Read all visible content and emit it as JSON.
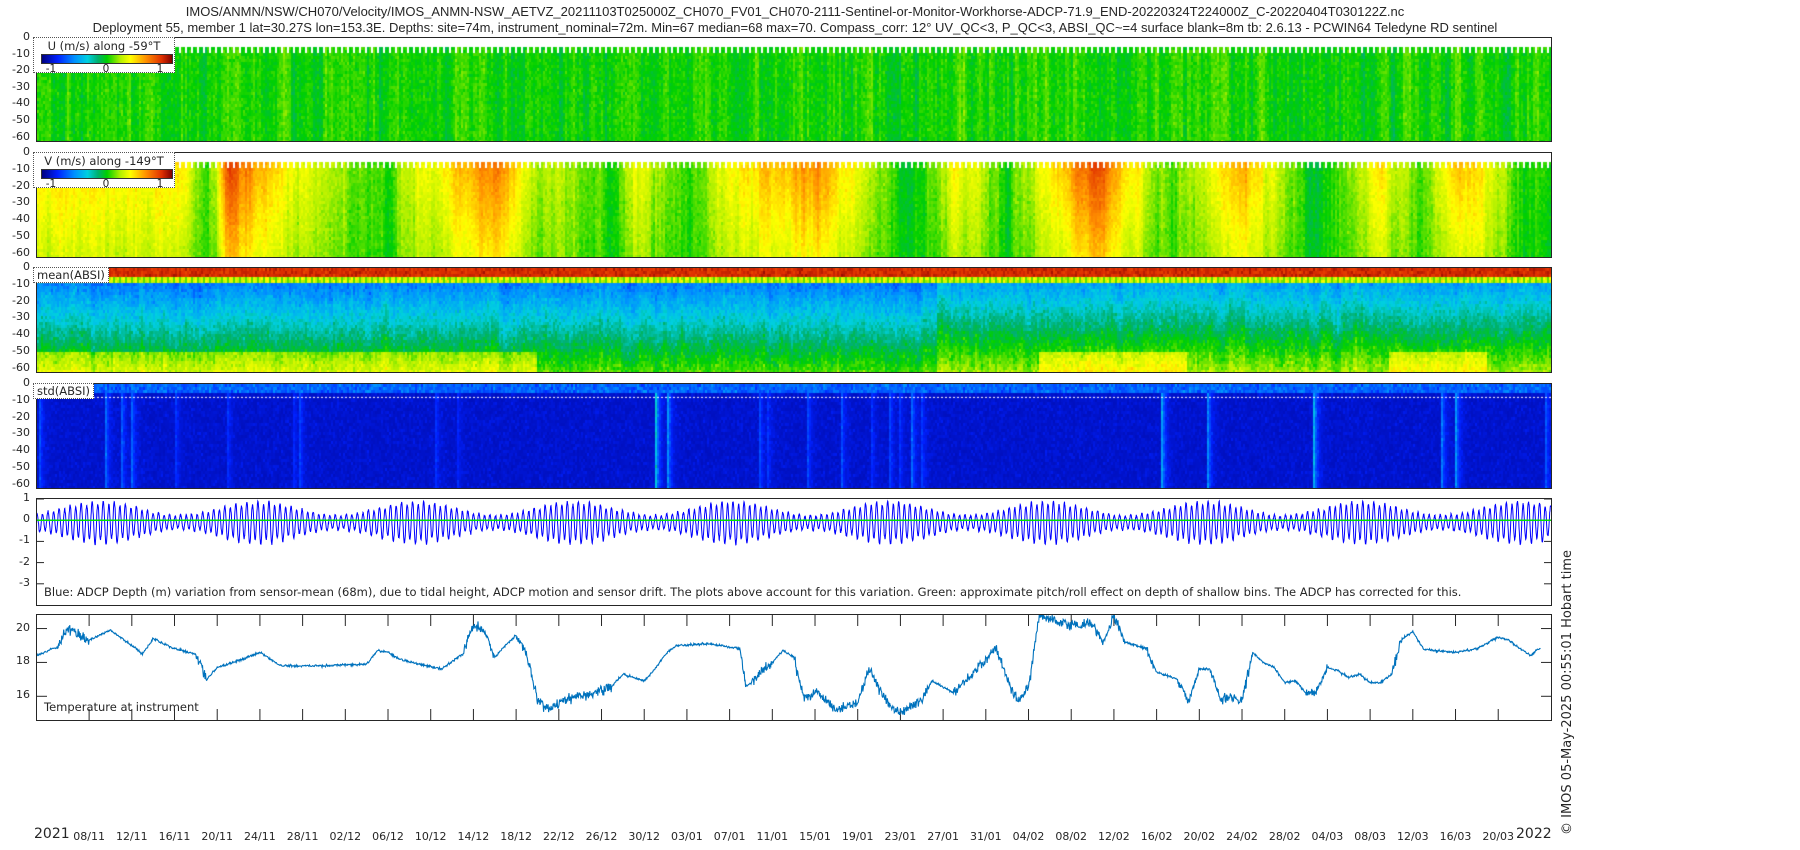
{
  "header": {
    "title_line1": "IMOS/ANMN/NSW/CH070/Velocity/IMOS_ANMN-NSW_AETVZ_20211103T025000Z_CH070_FV01_CH070-2111-Sentinel-or-Monitor-Workhorse-ADCP-71.9_END-20220324T224000Z_C-20220404T030122Z.nc",
    "title_line2": "Deployment 55, member 1 lat=30.27S lon=153.3E. Depths: site=74m, instrument_nominal=72m. Min=67 median=68 max=70. Compass_corr: 12° UV_QC<3, P_QC<3, ABSI_QC~=4 surface blank=8m tb: 2.6.13 - PCWIN64 Teledyne RD sentinel"
  },
  "footer": {
    "credit": "© IMOS 05-May-2025 00:55:01 Hobart time"
  },
  "xaxis": {
    "start": "2021-11-03T02:50:00Z",
    "end": "2022-03-24T22:40:00Z",
    "year_start": "2021",
    "year_end": "2022",
    "ticks": [
      {
        "date": "2021-11-08",
        "label": "08/11"
      },
      {
        "date": "2021-11-12",
        "label": "12/11"
      },
      {
        "date": "2021-11-16",
        "label": "16/11"
      },
      {
        "date": "2021-11-20",
        "label": "20/11"
      },
      {
        "date": "2021-11-24",
        "label": "24/11"
      },
      {
        "date": "2021-11-28",
        "label": "28/11"
      },
      {
        "date": "2021-12-02",
        "label": "02/12"
      },
      {
        "date": "2021-12-06",
        "label": "06/12"
      },
      {
        "date": "2021-12-10",
        "label": "10/12"
      },
      {
        "date": "2021-12-14",
        "label": "14/12"
      },
      {
        "date": "2021-12-18",
        "label": "18/12"
      },
      {
        "date": "2021-12-22",
        "label": "22/12"
      },
      {
        "date": "2021-12-26",
        "label": "26/12"
      },
      {
        "date": "2021-12-30",
        "label": "30/12"
      },
      {
        "date": "2022-01-03",
        "label": "03/01"
      },
      {
        "date": "2022-01-07",
        "label": "07/01"
      },
      {
        "date": "2022-01-11",
        "label": "11/01"
      },
      {
        "date": "2022-01-15",
        "label": "15/01"
      },
      {
        "date": "2022-01-19",
        "label": "19/01"
      },
      {
        "date": "2022-01-23",
        "label": "23/01"
      },
      {
        "date": "2022-01-27",
        "label": "27/01"
      },
      {
        "date": "2022-01-31",
        "label": "31/01"
      },
      {
        "date": "2022-02-04",
        "label": "04/02"
      },
      {
        "date": "2022-02-08",
        "label": "08/02"
      },
      {
        "date": "2022-02-12",
        "label": "12/02"
      },
      {
        "date": "2022-02-16",
        "label": "16/02"
      },
      {
        "date": "2022-02-20",
        "label": "20/02"
      },
      {
        "date": "2022-02-24",
        "label": "24/02"
      },
      {
        "date": "2022-02-28",
        "label": "28/02"
      },
      {
        "date": "2022-03-04",
        "label": "04/03"
      },
      {
        "date": "2022-03-08",
        "label": "08/03"
      },
      {
        "date": "2022-03-12",
        "label": "12/03"
      },
      {
        "date": "2022-03-16",
        "label": "16/03"
      },
      {
        "date": "2022-03-20",
        "label": "20/03"
      }
    ]
  },
  "chart_data": [
    {
      "type": "heatmap",
      "id": "u",
      "label": "U (m/s) along -59°T",
      "colorbar": {
        "range": [
          -1.2,
          1.2
        ],
        "ticks": [
          {
            "value": -1,
            "label": "-1"
          },
          {
            "value": 0,
            "label": "0"
          },
          {
            "value": 1,
            "label": "1"
          }
        ]
      },
      "ylim": [
        -62,
        0
      ],
      "yticks": [
        {
          "value": 0,
          "label": "0"
        },
        {
          "value": -10,
          "label": "-10"
        },
        {
          "value": -20,
          "label": "-20"
        },
        {
          "value": -30,
          "label": "-30"
        },
        {
          "value": -40,
          "label": "-40"
        },
        {
          "value": -50,
          "label": "-50"
        },
        {
          "value": -60,
          "label": "-60"
        }
      ],
      "typical_value": 0.0,
      "typical_spread": 0.25
    },
    {
      "type": "heatmap",
      "id": "v",
      "label": "V (m/s) along -149°T",
      "colorbar": {
        "range": [
          -1.2,
          1.2
        ],
        "ticks": [
          {
            "value": -1,
            "label": "-1"
          },
          {
            "value": 0,
            "label": "0"
          },
          {
            "value": 1,
            "label": "1"
          }
        ]
      },
      "ylim": [
        -62,
        0
      ],
      "yticks": [
        {
          "value": 0,
          "label": "0"
        },
        {
          "value": -10,
          "label": "-10"
        },
        {
          "value": -20,
          "label": "-20"
        },
        {
          "value": -30,
          "label": "-30"
        },
        {
          "value": -40,
          "label": "-40"
        },
        {
          "value": -50,
          "label": "-50"
        },
        {
          "value": -60,
          "label": "-60"
        }
      ],
      "depth_mean_by_date": [
        [
          "2021-11-03",
          0.4
        ],
        [
          "2021-11-17",
          0.4
        ],
        [
          "2021-11-19",
          0.0
        ],
        [
          "2021-11-21",
          0.75
        ],
        [
          "2021-11-27",
          0.35
        ],
        [
          "2021-12-05",
          0.05
        ],
        [
          "2021-12-11",
          0.4
        ],
        [
          "2021-12-16",
          0.65
        ],
        [
          "2021-12-20",
          0.25
        ],
        [
          "2021-12-27",
          0.05
        ],
        [
          "2021-12-29",
          0.35
        ],
        [
          "2022-01-03",
          0.05
        ],
        [
          "2022-01-08",
          0.4
        ],
        [
          "2022-01-15",
          0.65
        ],
        [
          "2022-01-24",
          -0.1
        ],
        [
          "2022-01-28",
          0.4
        ],
        [
          "2022-02-02",
          0.05
        ],
        [
          "2022-02-10",
          0.8
        ],
        [
          "2022-02-17",
          0.05
        ],
        [
          "2022-02-24",
          0.55
        ],
        [
          "2022-03-03",
          -0.1
        ],
        [
          "2022-03-09",
          0.4
        ],
        [
          "2022-03-13",
          0.05
        ],
        [
          "2022-03-16",
          0.55
        ],
        [
          "2022-03-22",
          0.05
        ],
        [
          "2022-03-24",
          0.1
        ]
      ]
    },
    {
      "type": "heatmap",
      "id": "mean_absi",
      "label": "mean(ABSI)",
      "ylim": [
        -62,
        0
      ],
      "yticks": [
        {
          "value": 0,
          "label": "0"
        },
        {
          "value": -10,
          "label": "-10"
        },
        {
          "value": -20,
          "label": "-20"
        },
        {
          "value": -30,
          "label": "-30"
        },
        {
          "value": -40,
          "label": "-40"
        },
        {
          "value": -50,
          "label": "-50"
        },
        {
          "value": -60,
          "label": "-60"
        }
      ]
    },
    {
      "type": "heatmap",
      "id": "std_absi",
      "label": "std(ABSI)",
      "ylim": [
        -62,
        0
      ],
      "yticks": [
        {
          "value": 0,
          "label": "0"
        },
        {
          "value": -10,
          "label": "-10"
        },
        {
          "value": -20,
          "label": "-20"
        },
        {
          "value": -30,
          "label": "-30"
        },
        {
          "value": -40,
          "label": "-40"
        },
        {
          "value": -50,
          "label": "-50"
        },
        {
          "value": -60,
          "label": "-60"
        }
      ],
      "surface_blank_line_m": -8
    },
    {
      "type": "line",
      "id": "depth",
      "annotation": "Blue: ADCP Depth (m) variation from sensor-mean (68m), due to tidal height, ADCP motion and sensor drift. The plots above account for this variation. Green: approximate pitch/roll effect on depth of shallow bins. The ADCP has corrected for this.",
      "ylim": [
        -4,
        1
      ],
      "yticks": [
        {
          "value": 1,
          "label": "1"
        },
        {
          "value": 0,
          "label": "0"
        },
        {
          "value": -1,
          "label": "-1"
        },
        {
          "value": -2,
          "label": "-2"
        },
        {
          "value": -3,
          "label": "-3"
        }
      ],
      "series": [
        {
          "color": "#0000ff",
          "kind": "tidal",
          "range": [
            -1.2,
            0.9
          ],
          "period_hours": 12.42,
          "spring_neap_days": 14.77
        },
        {
          "color": "#00e000",
          "kind": "constant",
          "value": 0
        }
      ]
    },
    {
      "type": "line",
      "id": "temperature",
      "label": "Temperature at instrument",
      "ylim": [
        14.6,
        20.8
      ],
      "yticks": [
        {
          "value": 16,
          "label": "16"
        },
        {
          "value": 18,
          "label": "18"
        },
        {
          "value": 20,
          "label": "20"
        }
      ],
      "color": "#0072bd",
      "x": [
        "2021-11-03",
        "2021-11-05",
        "2021-11-06",
        "2021-11-08",
        "2021-11-10",
        "2021-11-12",
        "2021-11-13",
        "2021-11-14",
        "2021-11-16",
        "2021-11-18",
        "2021-11-19",
        "2021-11-20",
        "2021-11-22",
        "2021-11-24",
        "2021-11-26",
        "2021-11-30",
        "2021-12-04",
        "2021-12-05",
        "2021-12-06",
        "2021-12-07",
        "2021-12-09",
        "2021-12-11",
        "2021-12-13",
        "2021-12-14",
        "2021-12-15",
        "2021-12-16",
        "2021-12-17",
        "2021-12-18",
        "2021-12-19",
        "2021-12-20",
        "2021-12-21",
        "2021-12-23",
        "2021-12-25",
        "2021-12-27",
        "2021-12-28",
        "2021-12-30",
        "2021-12-31",
        "2022-01-01",
        "2022-01-02",
        "2022-01-05",
        "2022-01-08",
        "2022-01-08T12",
        "2022-01-09",
        "2022-01-11",
        "2022-01-12",
        "2022-01-13",
        "2022-01-14",
        "2022-01-15",
        "2022-01-16",
        "2022-01-17",
        "2022-01-19",
        "2022-01-20",
        "2022-01-21",
        "2022-01-22",
        "2022-01-23",
        "2022-01-25",
        "2022-01-26",
        "2022-01-28",
        "2022-01-30",
        "2022-02-01",
        "2022-02-02",
        "2022-02-03",
        "2022-02-04",
        "2022-02-05",
        "2022-02-08",
        "2022-02-10",
        "2022-02-11",
        "2022-02-12",
        "2022-02-13",
        "2022-02-15",
        "2022-02-16",
        "2022-02-17",
        "2022-02-18",
        "2022-02-19",
        "2022-02-20",
        "2022-02-21",
        "2022-02-22",
        "2022-02-23",
        "2022-02-24",
        "2022-02-25",
        "2022-02-26",
        "2022-02-27",
        "2022-02-28",
        "2022-03-01",
        "2022-03-02",
        "2022-03-03",
        "2022-03-04",
        "2022-03-05",
        "2022-03-06",
        "2022-03-07",
        "2022-03-08",
        "2022-03-09",
        "2022-03-10",
        "2022-03-11",
        "2022-03-12",
        "2022-03-13",
        "2022-03-14",
        "2022-03-16",
        "2022-03-18",
        "2022-03-20",
        "2022-03-21",
        "2022-03-23",
        "2022-03-24"
      ],
      "y": [
        18.4,
        18.9,
        20.0,
        19.3,
        19.9,
        19.0,
        18.5,
        19.4,
        18.8,
        18.5,
        17.0,
        17.7,
        18.1,
        18.6,
        17.8,
        17.8,
        17.9,
        18.7,
        18.6,
        18.2,
        17.9,
        17.6,
        18.5,
        20.2,
        19.8,
        18.3,
        19.0,
        19.6,
        18.5,
        15.8,
        15.2,
        15.9,
        16.1,
        16.6,
        17.3,
        16.9,
        17.6,
        18.5,
        19.0,
        19.1,
        18.8,
        16.6,
        16.8,
        18.0,
        18.7,
        18.3,
        15.9,
        16.3,
        15.8,
        15.2,
        15.6,
        17.6,
        16.5,
        15.4,
        15.0,
        15.8,
        16.9,
        16.2,
        17.5,
        18.8,
        17.0,
        15.7,
        16.5,
        20.8,
        20.2,
        20.3,
        19.1,
        20.8,
        19.2,
        18.8,
        17.4,
        17.2,
        17.0,
        15.7,
        17.6,
        17.6,
        15.8,
        16.0,
        15.7,
        18.6,
        18.0,
        17.7,
        16.8,
        16.9,
        16.2,
        16.3,
        17.7,
        17.5,
        17.1,
        17.3,
        16.8,
        16.8,
        17.3,
        19.4,
        19.8,
        18.8,
        18.7,
        18.6,
        18.8,
        19.5,
        19.3,
        18.4,
        18.9
      ]
    }
  ]
}
